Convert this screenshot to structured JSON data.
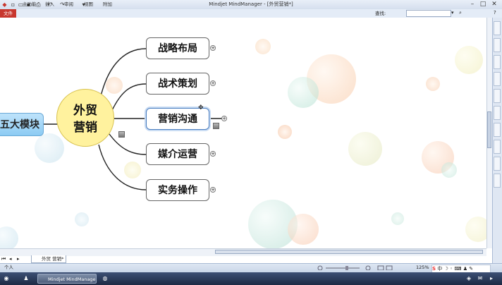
{
  "window": {
    "title": "Mindjet MindManager - [外贸营销*]"
  },
  "ribbon": {
    "file_tab": "文件",
    "tabs": [
      "主功能",
      "插入",
      "审阅",
      "视图",
      "附加"
    ],
    "search_label": "查找:",
    "search_placeholder": ""
  },
  "map": {
    "central_topic": [
      "外贸",
      "营销"
    ],
    "left_topic": "五大模块",
    "subtopics": [
      "战略布局",
      "战术策划",
      "营销沟通",
      "媒介运营",
      "实务操作"
    ],
    "selected_index": 2
  },
  "bottom": {
    "document_tab": "外贸 营销*",
    "zoom": "125%"
  },
  "status": {
    "user": "个人"
  },
  "taskbar": {
    "active_item": "Mindjet MindManager",
    "ime": "中"
  },
  "colors": {
    "file_tab": "#c8372e",
    "central_fill": "#fff29e",
    "left_topic_fill": "#8ccbf3",
    "selection": "#4a7dbf"
  },
  "icons": [
    "app-icon",
    "save-icon",
    "undo-icon",
    "redo-icon",
    "minimize-icon",
    "maximize-icon",
    "close-icon",
    "expand-icon",
    "note-icon",
    "sogou-ime-icon"
  ]
}
